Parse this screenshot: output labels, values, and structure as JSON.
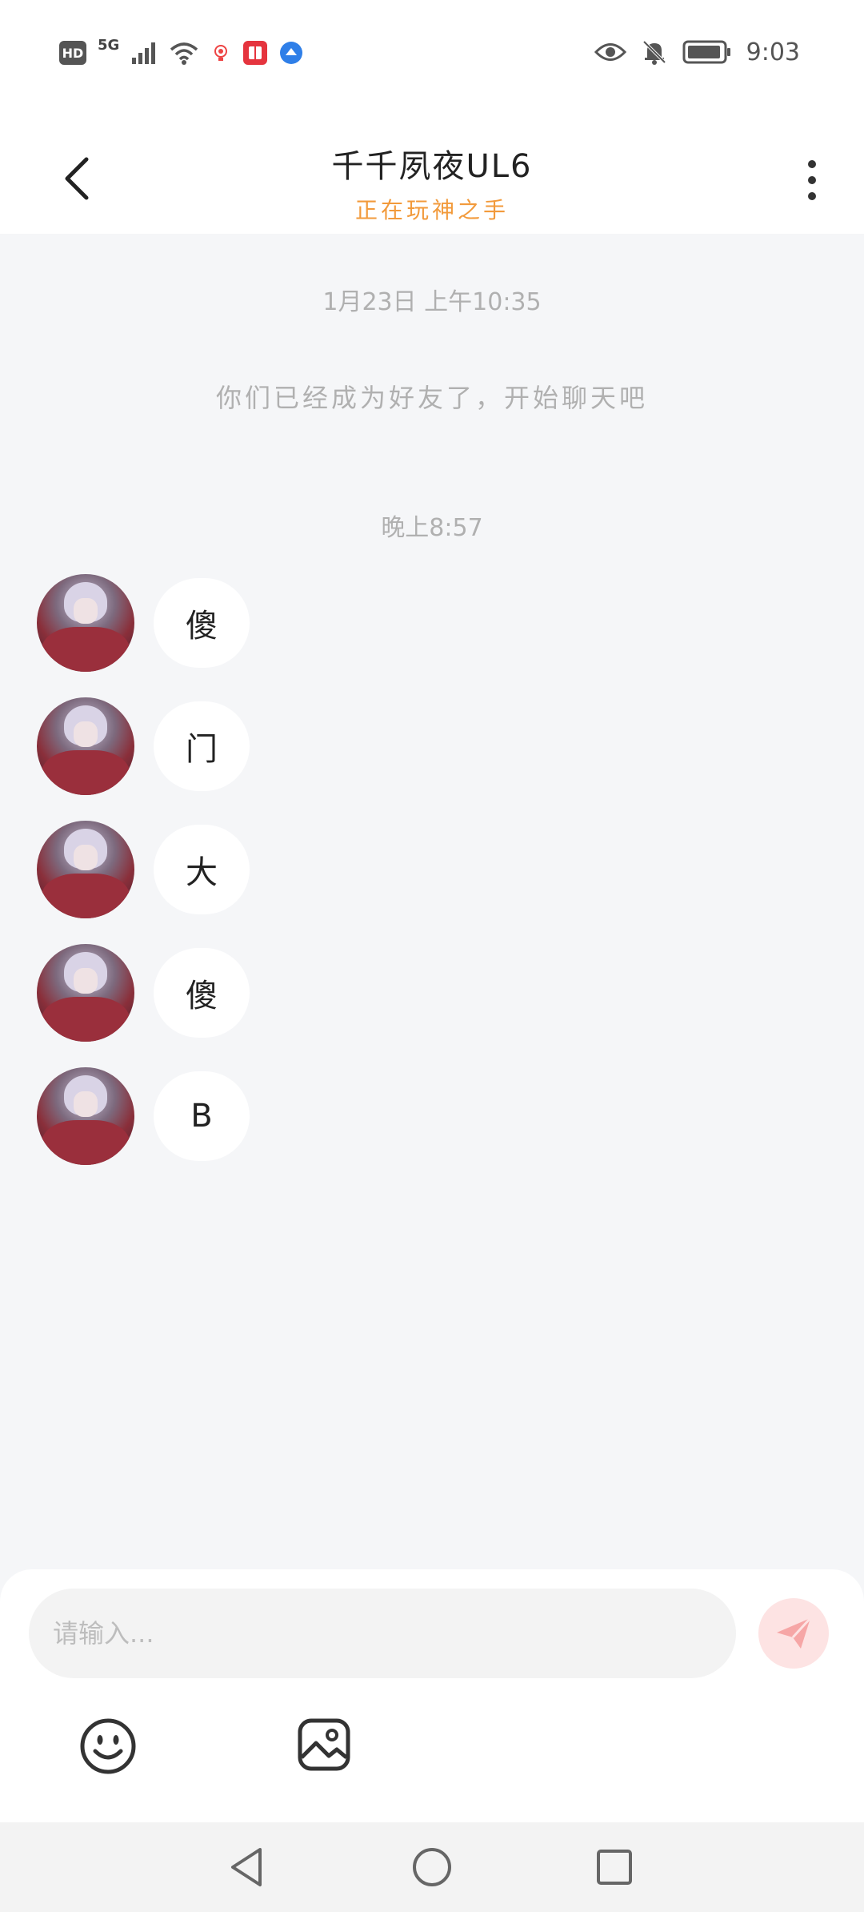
{
  "status_bar": {
    "hd_label": "HD",
    "network_label": "5G",
    "time": "9:03",
    "icons": [
      "hd-icon",
      "signal-icon",
      "wifi-icon",
      "app-notification-icon",
      "book-app-icon",
      "browser-app-icon",
      "eye-icon",
      "bell-off-icon",
      "battery-icon"
    ]
  },
  "header": {
    "title": "千千夙夜UL6",
    "subtitle": "正在玩神之手",
    "back_icon": "chevron-left-icon",
    "more_icon": "more-vertical-icon"
  },
  "chat": {
    "first_timestamp": "1月23日 上午10:35",
    "system_message": "你们已经成为好友了，开始聊天吧",
    "second_timestamp": "晚上8:57",
    "messages": [
      {
        "text": "傻"
      },
      {
        "text": "门"
      },
      {
        "text": "大"
      },
      {
        "text": "傻"
      },
      {
        "text": "B"
      }
    ]
  },
  "input_bar": {
    "placeholder": "请输入...",
    "send_icon": "send-icon",
    "emoji_icon": "emoji-icon",
    "image_icon": "image-icon"
  },
  "nav_bar": {
    "icons": [
      "back-triangle-icon",
      "home-circle-icon",
      "recents-square-icon"
    ]
  },
  "colors": {
    "accent_orange": "#f29a3b",
    "send_button_bg": "#fde3e3",
    "send_icon": "#f6a6a6",
    "chat_bg": "#f5f6f8"
  }
}
